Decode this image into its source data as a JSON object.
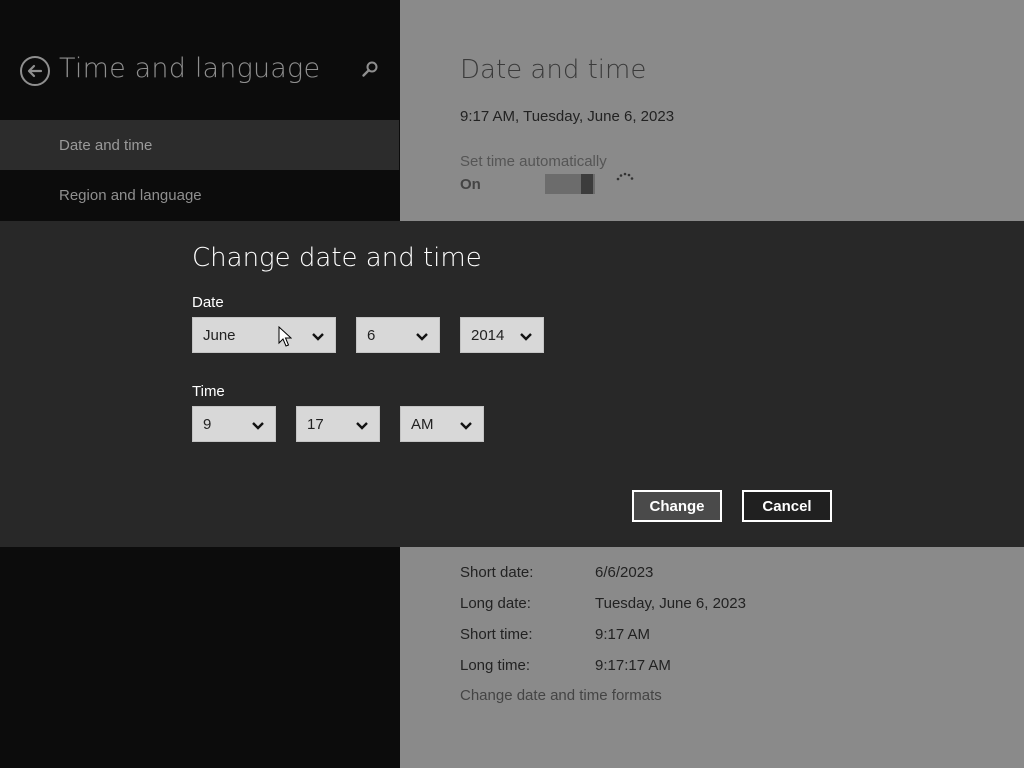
{
  "left_pane": {
    "title": "Time and language",
    "nav": [
      {
        "label": "Date and time",
        "selected": true
      },
      {
        "label": "Region and language",
        "selected": false
      }
    ],
    "icons": {
      "back": "back-arrow-icon",
      "search": "search-icon"
    }
  },
  "right_pane": {
    "title": "Date and time",
    "current_datetime": "9:17 AM, Tuesday, June 6, 2023",
    "set_time_auto_label": "Set time automatically",
    "set_time_auto_state": "On",
    "formats": [
      {
        "key": "Short date:",
        "value": "6/6/2023"
      },
      {
        "key": "Long date:",
        "value": "Tuesday, June 6, 2023"
      },
      {
        "key": "Short time:",
        "value": "9:17 AM"
      },
      {
        "key": "Long time:",
        "value": "9:17:17 AM"
      }
    ],
    "change_formats_link": "Change date and time formats"
  },
  "dialog": {
    "title": "Change date and time",
    "date_label": "Date",
    "month": "June",
    "day": "6",
    "year": "2014",
    "time_label": "Time",
    "hour": "9",
    "minute": "17",
    "ampm": "AM",
    "change_button": "Change",
    "cancel_button": "Cancel"
  },
  "colors": {
    "modal_bg": "#282828",
    "left_bg": "#0c0c0c",
    "right_dim_bg": "#8a8a8a",
    "dropdown_bg": "#d8d8d8"
  }
}
